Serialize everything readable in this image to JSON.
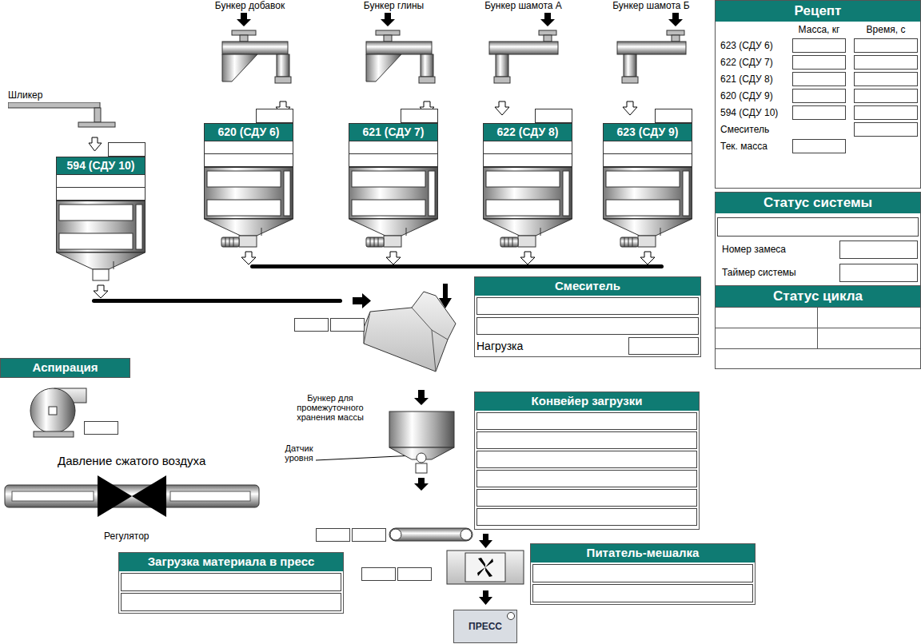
{
  "slip": {
    "label": "Шликер"
  },
  "bunkers": [
    {
      "label": "Бункер добавок",
      "kind": "inclined"
    },
    {
      "label": "Бункер глины",
      "kind": "inclined"
    },
    {
      "label": "Бункер шамота А",
      "kind": "straight"
    },
    {
      "label": "Бункер шамота Б",
      "kind": "straight"
    }
  ],
  "tanks": [
    {
      "label": "594 (СДУ 10)",
      "kind": "outlet"
    },
    {
      "label": "620 (СДУ 6)",
      "kind": "motor"
    },
    {
      "label": "621 (СДУ 7)",
      "kind": "motor"
    },
    {
      "label": "622 (СДУ 8)",
      "kind": "motor"
    },
    {
      "label": "623 (СДУ 9)",
      "kind": "motor"
    }
  ],
  "recipe": {
    "title": "Рецепт",
    "columns": [
      "Масса, кг",
      "Время, с"
    ],
    "rows": [
      {
        "label": "623 (СДУ 6)",
        "kind": "mass-time"
      },
      {
        "label": "622 (СДУ 7)",
        "kind": "mass-time"
      },
      {
        "label": "621 (СДУ 8)",
        "kind": "mass-time"
      },
      {
        "label": "620 (СДУ 9)",
        "kind": "mass-time"
      },
      {
        "label": "594 (СДУ 10)",
        "kind": "mass-time"
      },
      {
        "label": "Смеситель",
        "kind": "time"
      },
      {
        "label": "Тек. масса",
        "kind": "mass"
      }
    ]
  },
  "system_status": {
    "title": "Статус системы",
    "fields": [
      "Номер замеса",
      "Таймер системы"
    ]
  },
  "cycle_status": {
    "title": "Статус цикла"
  },
  "mixer": {
    "title": "Смеситель",
    "load_label": "Нагрузка"
  },
  "aspiration": {
    "title": "Аспирация"
  },
  "air": {
    "label": "Давление сжатого воздуха",
    "regulator": "Регулятор"
  },
  "hopper": {
    "label": "Бункер для промежуточного хранения массы",
    "sensor": "Датчик уровня"
  },
  "conveyor": {
    "title": "Конвейер загрузки"
  },
  "feeder": {
    "title": "Питатель-мешалка"
  },
  "press_load": {
    "title": "Загрузка материала в пресс"
  },
  "press": {
    "label": "ПРЕСС"
  }
}
